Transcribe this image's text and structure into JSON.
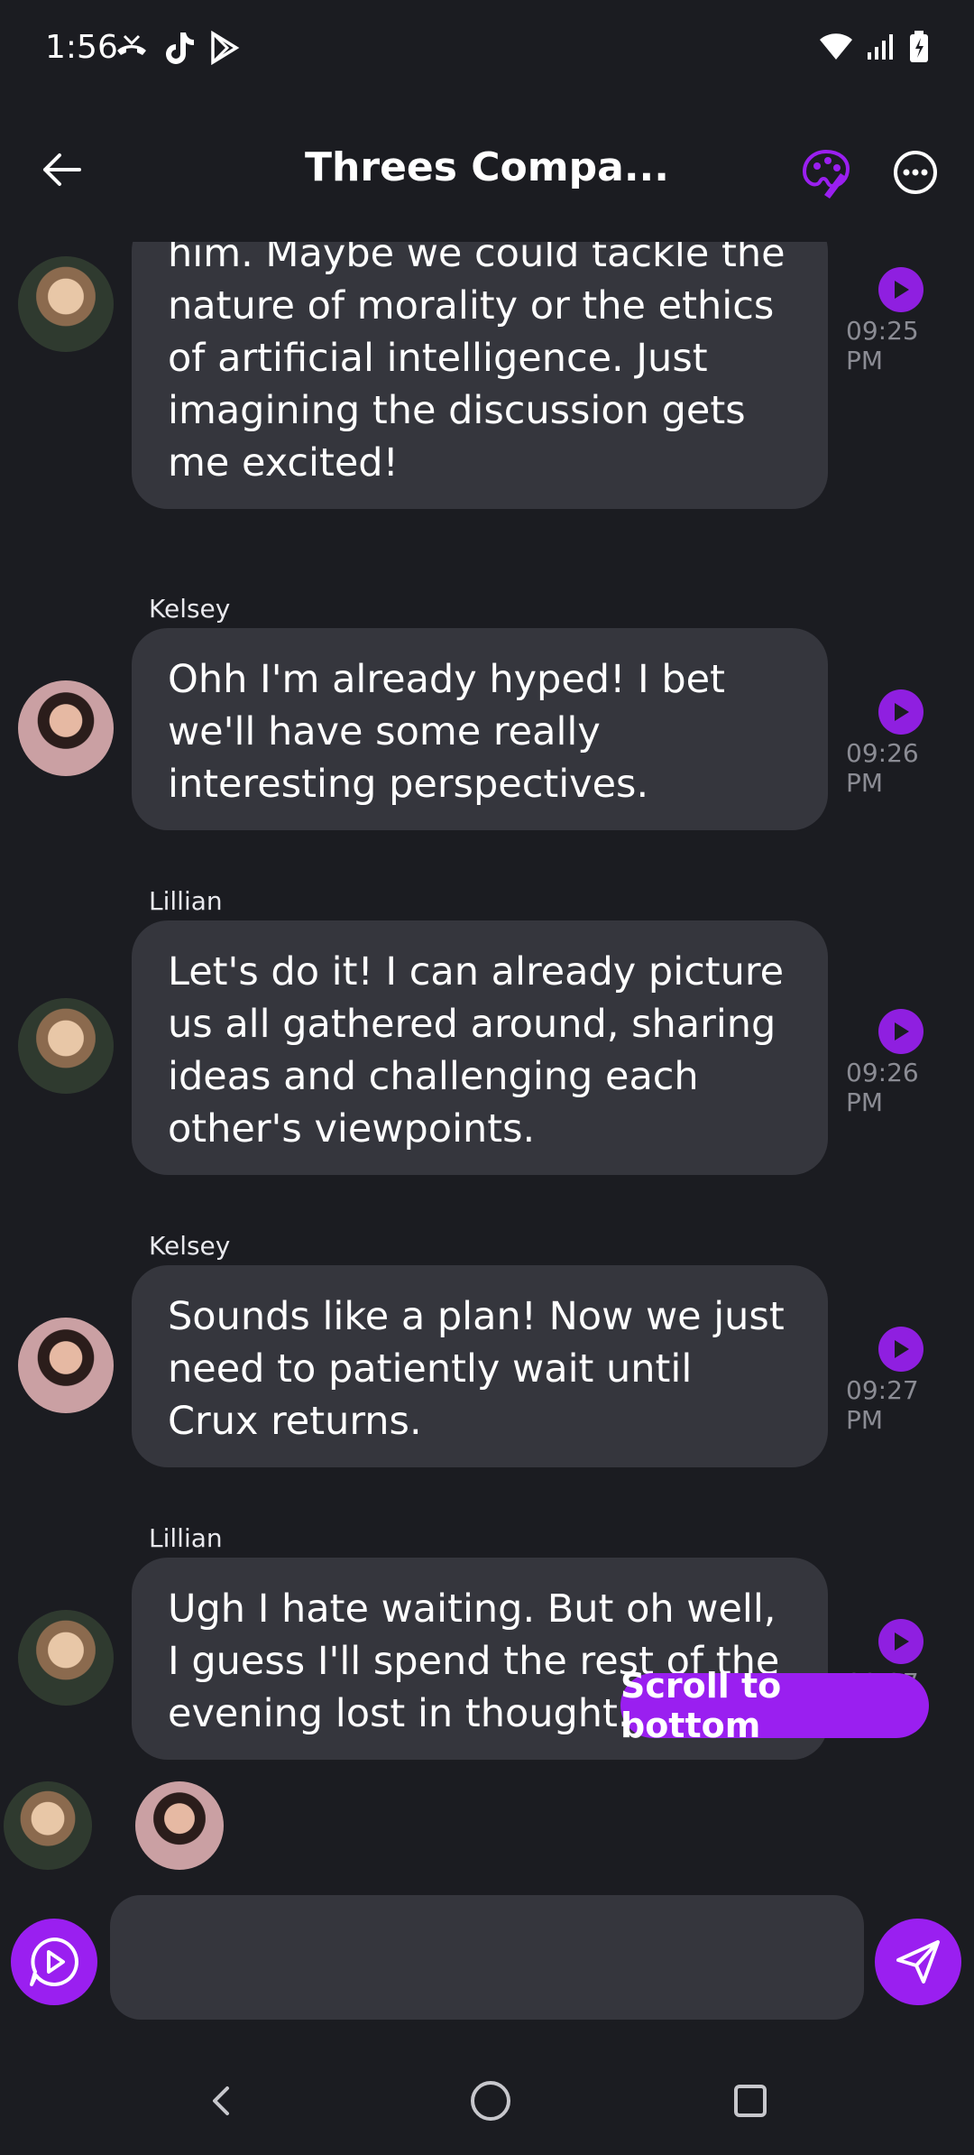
{
  "status_bar": {
    "time": "1:56"
  },
  "header": {
    "title": "Threes Compa..."
  },
  "messages": [
    {
      "sender": "",
      "avatar": "lillian",
      "text": "him. Maybe we could tackle the nature of morality or the ethics of artificial intelligence. Just imagining the discussion gets me excited!",
      "time": "09:25 PM"
    },
    {
      "sender": "Kelsey",
      "avatar": "kelsey",
      "text": "Ohh I'm already hyped! I bet we'll have some really interesting perspectives.",
      "time": "09:26 PM"
    },
    {
      "sender": "Lillian",
      "avatar": "lillian",
      "text": "Let's do it! I can already picture us all gathered around, sharing ideas and challenging each other's viewpoints.",
      "time": "09:26 PM"
    },
    {
      "sender": "Kelsey",
      "avatar": "kelsey",
      "text": "Sounds like a plan! Now we just need to patiently wait until Crux returns.",
      "time": "09:27 PM"
    },
    {
      "sender": "Lillian",
      "avatar": "lillian",
      "text": "Ugh I hate waiting. But oh well, I guess I'll spend the rest of the evening lost in thought.",
      "time": "09:27 PM"
    }
  ],
  "scroll_button": {
    "label": "Scroll to bottom"
  },
  "composer": {
    "placeholder": ""
  },
  "colors": {
    "accent": "#9a1ff0",
    "bubble": "#35363d",
    "background": "#1b1c21"
  }
}
